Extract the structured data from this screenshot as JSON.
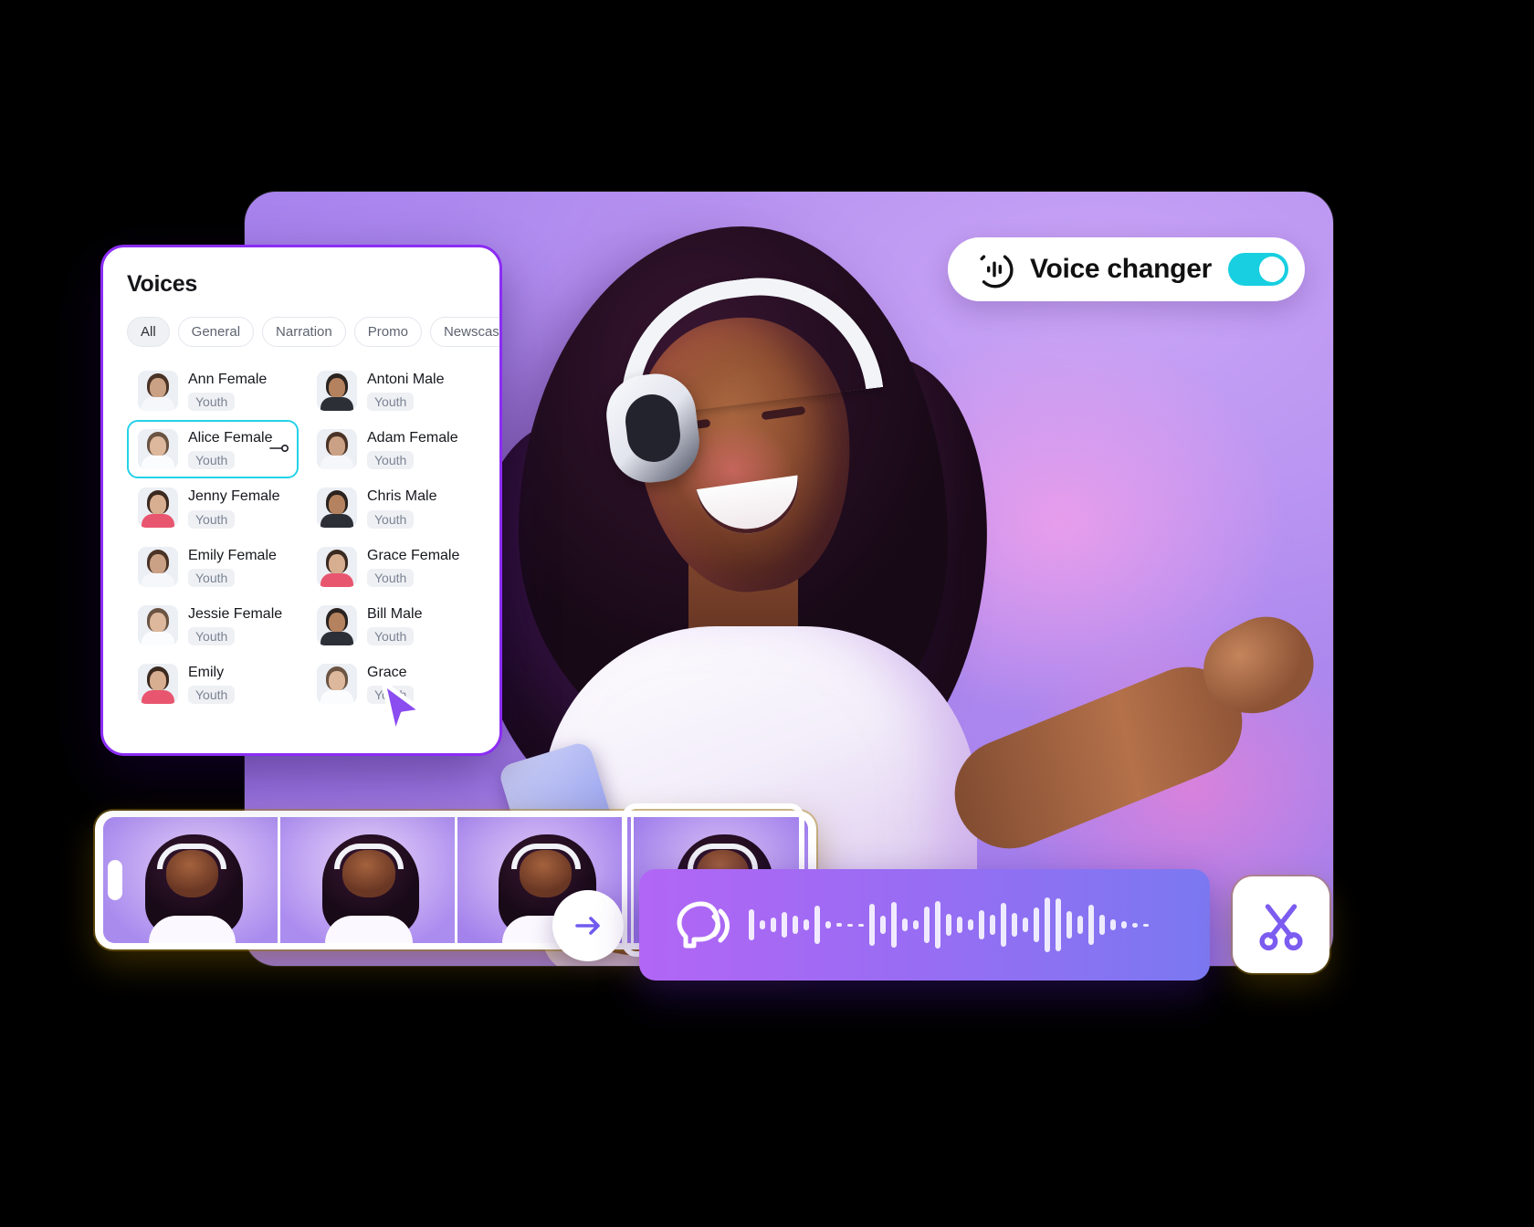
{
  "colors": {
    "brand_purple": "#8b2cf5",
    "accent_cyan": "#17cfe0",
    "selected_border": "#24d2e8",
    "wave_left": "#b266f5",
    "wave_right": "#7b78f2",
    "scissors": "#7c5cf0"
  },
  "voice_changer": {
    "label": "Voice changer",
    "icon": "audio-waveform-circle-icon",
    "toggle_state": "on",
    "toggle_icon": "toggle-switch-icon"
  },
  "voices_panel": {
    "title": "Voices",
    "filter_icon": "filter-funnel-icon",
    "chips": [
      {
        "label": "All",
        "active": true
      },
      {
        "label": "General",
        "active": false
      },
      {
        "label": "Narration",
        "active": false
      },
      {
        "label": "Promo",
        "active": false
      },
      {
        "label": "Newscast",
        "active": false
      }
    ],
    "items": [
      {
        "name": "Ann Female",
        "tag": "Youth",
        "gender": "f",
        "selected": false
      },
      {
        "name": "Antoni Male",
        "tag": "Youth",
        "gender": "m",
        "selected": false
      },
      {
        "name": "Alice Female",
        "tag": "Youth",
        "gender": "f",
        "selected": true
      },
      {
        "name": "Adam Female",
        "tag": "Youth",
        "gender": "f",
        "selected": false
      },
      {
        "name": "Jenny Female",
        "tag": "Youth",
        "gender": "f",
        "selected": false
      },
      {
        "name": "Chris Male",
        "tag": "Youth",
        "gender": "m",
        "selected": false
      },
      {
        "name": "Emily Female",
        "tag": "Youth",
        "gender": "f",
        "selected": false
      },
      {
        "name": "Grace Female",
        "tag": "Youth",
        "gender": "f",
        "selected": false
      },
      {
        "name": "Jessie Female",
        "tag": "Youth",
        "gender": "f",
        "selected": false
      },
      {
        "name": "Bill Male",
        "tag": "Youth",
        "gender": "m",
        "selected": false
      },
      {
        "name": "Emily",
        "tag": "Youth",
        "gender": "f",
        "selected": false
      },
      {
        "name": "Grace",
        "tag": "Youth",
        "gender": "f",
        "selected": false
      }
    ],
    "cursor_icon": "mouse-pointer-icon",
    "row_play_icon": "play-slider-icon"
  },
  "timeline": {
    "clip_count": 4,
    "selected_clip_index": 3,
    "handle_icon": "trim-handle-icon",
    "next_button_icon": "arrow-right-icon",
    "cut_button_icon": "scissors-icon"
  },
  "audio_track": {
    "icon": "speaking-head-icon",
    "waveform": [
      34,
      10,
      16,
      28,
      20,
      12,
      42,
      8,
      4,
      3,
      2,
      46,
      20,
      50,
      14,
      10,
      40,
      52,
      24,
      18,
      12,
      32,
      22,
      48,
      26,
      16,
      38,
      60,
      58,
      30,
      20,
      44,
      22,
      12,
      8,
      5,
      3
    ]
  }
}
